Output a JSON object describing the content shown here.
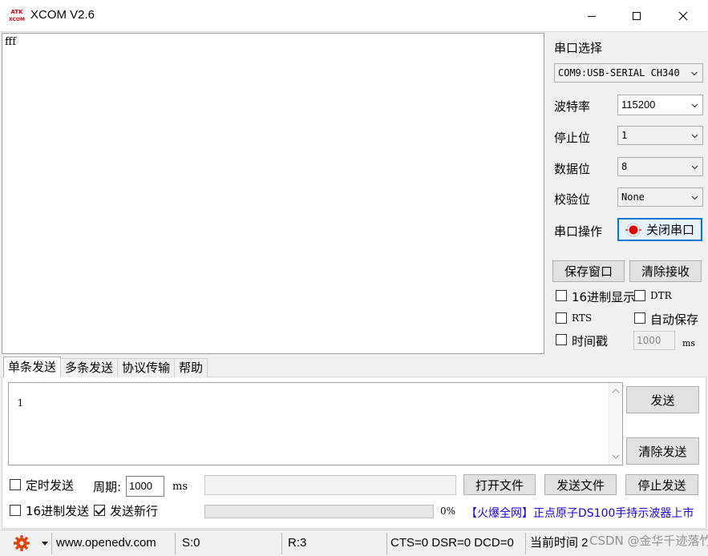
{
  "window": {
    "title": "XCOM V2.6",
    "logo_text_top": "ATK",
    "logo_text_bottom": "XCOM",
    "minimize_icon": "minimize-icon",
    "maximize_icon": "maximize-icon",
    "close_icon": "close-icon"
  },
  "receive": {
    "text": "fff"
  },
  "serial": {
    "port_select_label": "串口选择",
    "port_value": "COM9:USB-SERIAL CH340",
    "baud_label": "波特率",
    "baud_value": "115200",
    "stop_label": "停止位",
    "stop_value": "1",
    "data_label": "数据位",
    "data_value": "8",
    "parity_label": "校验位",
    "parity_value": "None",
    "operation_label": "串口操作",
    "toggle_port_label": "关闭串口",
    "port_status_color": "#e00000"
  },
  "receive_controls": {
    "save_window_label": "保存窗口",
    "clear_receive_label": "清除接收",
    "hex_display_label": "16进制显示",
    "hex_display_checked": false,
    "dtr_label": "DTR",
    "dtr_checked": false,
    "rts_label": "RTS",
    "rts_checked": false,
    "auto_save_label": "自动保存",
    "auto_save_checked": false,
    "timestamp_label": "时间戳",
    "timestamp_checked": false,
    "timestamp_value": "1000",
    "timestamp_unit": "ms"
  },
  "tabs": [
    {
      "label": "单条发送",
      "active": true
    },
    {
      "label": "多条发送",
      "active": false
    },
    {
      "label": "协议传输",
      "active": false
    },
    {
      "label": "帮助",
      "active": false
    }
  ],
  "send": {
    "text": "1",
    "send_label": "发送",
    "clear_send_label": "清除发送",
    "timed_send_label": "定时发送",
    "timed_send_checked": false,
    "period_label": "周期:",
    "period_value": "1000",
    "period_unit": "ms",
    "open_file_label": "打开文件",
    "send_file_label": "发送文件",
    "stop_send_label": "停止发送",
    "hex_send_label": "16进制发送",
    "hex_send_checked": false,
    "newline_label": "发送新行",
    "newline_checked": true,
    "progress_text": "0%",
    "progress": 0,
    "promo_text": "【火爆全网】正点原子DS100手持示波器上市"
  },
  "statusbar": {
    "settings_icon": "gear-icon",
    "website": "www.openedv.com",
    "sent": "S:0",
    "received": "R:3",
    "lines": "CTS=0 DSR=0 DCD=0",
    "time_label": "当前时间 2",
    "watermark": "CSDN @金华千迹落竹",
    "accent_color": "#e0450f"
  }
}
